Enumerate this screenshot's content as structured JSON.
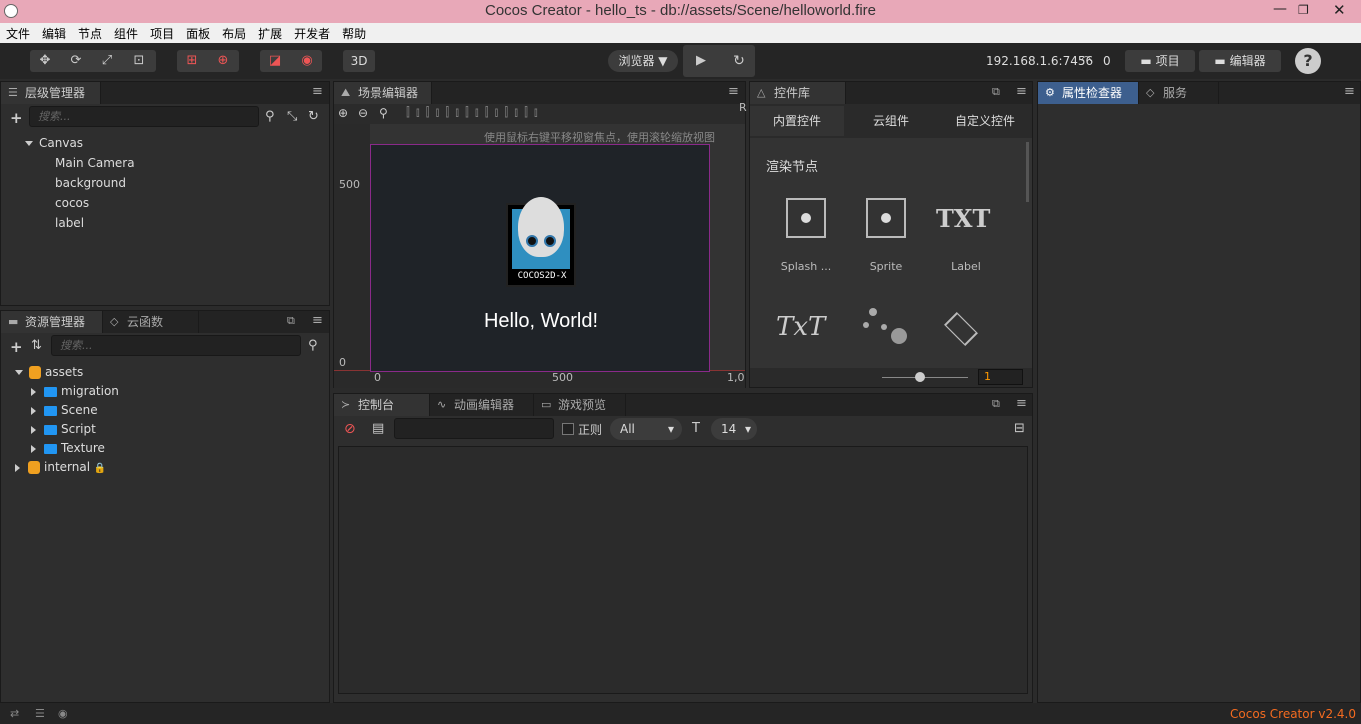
{
  "title": "Cocos Creator - hello_ts - db://assets/Scene/helloworld.fire",
  "menu": [
    "文件",
    "编辑",
    "节点",
    "组件",
    "项目",
    "面板",
    "布局",
    "扩展",
    "开发者",
    "帮助"
  ],
  "toolbar": {
    "mode_3d": "3D",
    "preview_target": "浏览器 ▼",
    "ip": "192.168.1.6:7456",
    "device_count": "0",
    "project_btn": "项目",
    "editor_btn": "编辑器",
    "help_icon": "?"
  },
  "hierarchy": {
    "tab": "层级管理器",
    "search_placeholder": "搜索...",
    "root": "Canvas",
    "children": [
      "Main Camera",
      "background",
      "cocos",
      "label"
    ]
  },
  "assets": {
    "tab": "资源管理器",
    "tab2": "云函数",
    "search_placeholder": "搜索...",
    "root": "assets",
    "folders": [
      "migration",
      "Scene",
      "Script",
      "Texture"
    ],
    "internal": "internal"
  },
  "scene_editor": {
    "tab": "场景编辑器",
    "hint": "使用鼠标右键平移视窗焦点，使用滚轮缩放视图",
    "y_labels": [
      "500",
      "0"
    ],
    "x_labels": [
      "0",
      "500",
      "1,0"
    ],
    "logo_text": "COCOS2D-X",
    "hello": "Hello, World!",
    "r_label": "R"
  },
  "widgets": {
    "tab": "控件库",
    "subtabs": [
      "内置控件",
      "云组件",
      "自定义控件"
    ],
    "section": "渲染节点",
    "items": [
      "Splash ...",
      "Sprite",
      "Label"
    ],
    "scale_value": "1"
  },
  "inspector": {
    "tab": "属性检查器",
    "tab2": "服务"
  },
  "console": {
    "tab": "控制台",
    "tab2": "动画编辑器",
    "tab3": "游戏预览",
    "regex_label": "正则",
    "level": "All",
    "font_size": "14"
  },
  "status": {
    "version": "Cocos Creator v2.4.0"
  }
}
